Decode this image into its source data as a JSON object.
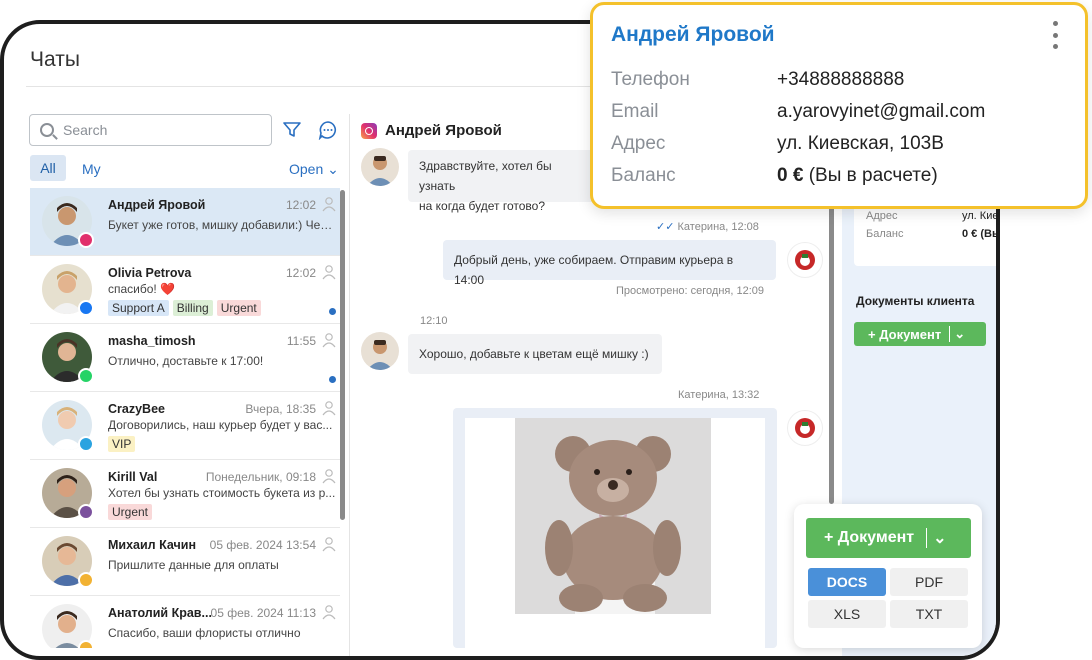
{
  "page": {
    "title": "Чаты"
  },
  "search": {
    "placeholder": "Search"
  },
  "tabs": {
    "all": "All",
    "my": "My",
    "status": "Open"
  },
  "chats": [
    {
      "name": "Андрей Яровой",
      "time": "12:02",
      "message": "Букет уже готов, мишку добавили:) Чер...",
      "channel": "instagram",
      "tags": [],
      "unread": false,
      "active": true
    },
    {
      "name": "Olivia Petrova",
      "time": "12:02",
      "message": "спасибо! ❤️",
      "channel": "messenger",
      "tags": [
        {
          "label": "Support A",
          "color": "#d7e6f7"
        },
        {
          "label": "Billing",
          "color": "#dcefd6"
        },
        {
          "label": "Urgent",
          "color": "#f9d9d9"
        }
      ],
      "unread": true,
      "active": false
    },
    {
      "name": "masha_timosh",
      "time": "11:55",
      "message": "Отлично, доставьте к 17:00!",
      "channel": "whatsapp",
      "tags": [],
      "unread": true,
      "active": false
    },
    {
      "name": "CrazyBee",
      "time": "Вчера, 18:35",
      "message": "Договорились, наш курьер будет у вас...",
      "channel": "telegram",
      "tags": [
        {
          "label": "VIP",
          "color": "#fbf1c4"
        }
      ],
      "unread": false,
      "active": false
    },
    {
      "name": "Kirill Val",
      "time": "Понедельник, 09:18",
      "message": "Хотел бы узнать стоимость букета из р...",
      "channel": "viber",
      "tags": [
        {
          "label": "Urgent",
          "color": "#f9d9d9"
        }
      ],
      "unread": false,
      "active": false
    },
    {
      "name": "Михаил Качин",
      "time": "05 фев. 2024 13:54",
      "message": "Пришлите данные для оплаты",
      "channel": "other",
      "tags": [],
      "unread": false,
      "active": false
    },
    {
      "name": "Анатолий Крав...",
      "time": "05 фев. 2024 11:13",
      "message": "Спасибо, ваши флористы отлично",
      "channel": "other",
      "tags": [],
      "unread": false,
      "active": false
    }
  ],
  "conversation": {
    "contact": "Андрей Яровой",
    "msg1": "Здравствуйте, хотел бы узнать",
    "msg1b": "на когда будет готово?",
    "meta1": "Катерина, 12:08",
    "msg2": "Добрый день, уже собираем. Отправим курьера в 14:00",
    "meta2": "Просмотрено: сегодня, 12:09",
    "meta3": "12:10",
    "msg3": "Хорошо, добавьте к цветам ещё мишку :)",
    "meta4": "Катерина, 13:32"
  },
  "right_panel": {
    "address_label": "Адрес",
    "address_value": "ул. Кие",
    "balance_label": "Баланс",
    "balance_value": "0 € (Вы",
    "docs_title": "Документы клиента",
    "doc_button": "+ Документ"
  },
  "profile_card": {
    "name": "Андрей Яровой",
    "phone_label": "Телефон",
    "phone": "+34888888888",
    "email_label": "Email",
    "email": "a.yarovyinet@gmail.com",
    "address_label": "Адрес",
    "address": "ул. Киевская, 103B",
    "balance_label": "Баланс",
    "balance_amount": "0 €",
    "balance_note": "(Вы в расчете)"
  },
  "doc_popup": {
    "button": "+ Документ",
    "formats": [
      "DOCS",
      "PDF",
      "XLS",
      "TXT"
    ]
  }
}
